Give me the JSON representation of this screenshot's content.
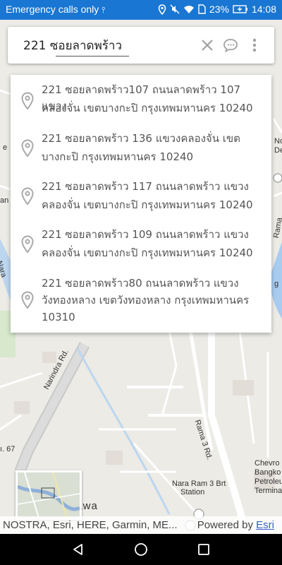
{
  "status_bar": {
    "carrier_text": "Emergency calls only",
    "battery_percent": "23%",
    "time": "14:08"
  },
  "search": {
    "value": "221 ซอยลาดพร้าว",
    "clear_icon": "close-icon",
    "voice_icon": "speech-bubble-icon",
    "menu_icon": "more-vert-icon"
  },
  "suggestions": [
    {
      "line1": "221 ซอยลาดพร้าว107 ถนนลาดพร้าว 107 แขวง",
      "line2": "คลองจั่น เขตบางกะปิ กรุงเทพมหานคร 10240",
      "line3": ""
    },
    {
      "line1": "221 ซอยลาดพร้าว 136  แขวงคลองจั่น เขต",
      "line2": "บางกะปิ กรุงเทพมหานคร 10240",
      "line3": ""
    },
    {
      "line1": "221 ซอยลาดพร้าว 117 ถนนลาดพร้าว แขวง",
      "line2": "คลองจั่น เขตบางกะปิ กรุงเทพมหานคร 10240",
      "line3": ""
    },
    {
      "line1": "221 ซอยลาดพร้าว 109 ถนนลาดพร้าว แขวง",
      "line2": "คลองจั่น เขตบางกะปิ กรุงเทพมหานคร 10240",
      "line3": ""
    },
    {
      "line1": "221 ซอยลาดพร้าว80 ถนนลาดพร้าว แขวง",
      "line2": "วังทองหลาง เขตวังทองหลาง กรุงเทพมหานคร",
      "line3": "10310"
    }
  ],
  "map_labels": {
    "road_rama3": "Rama 3 Rd.",
    "road_narindra": "Narindra Rd.",
    "nara_ram": "Nara Ram 3 Brt",
    "station": "Station",
    "chevron1": "Chevro",
    "chevron2": "Bangko",
    "chevron3": "Petroleu",
    "chevron4": "Termina",
    "area_nawa": "n Nawa",
    "soi67": "ı. 67",
    "nara_left": "Nara",
    "rama_right": "Rama",
    "no": "No",
    "de": "De",
    "an": "an",
    "e_letter": "e",
    "g_letter": "g"
  },
  "attribution": {
    "left": "NOSTRA, Esri, HERE, Garmin, ME...",
    "powered": "Powered by",
    "esri": "Esri"
  },
  "navbar": {
    "back_icon": "back-triangle-icon",
    "home_icon": "home-circle-icon",
    "recents_icon": "recents-square-icon"
  }
}
